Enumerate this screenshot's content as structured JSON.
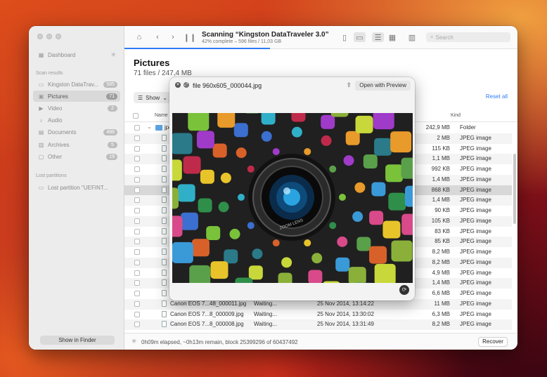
{
  "sidebar": {
    "items": [
      {
        "label": "Dashboard",
        "icon": "grid-icon"
      },
      {
        "label": "Kingston DataTrav...",
        "count": "585",
        "icon": "drive-icon"
      },
      {
        "label": "Pictures",
        "count": "71",
        "icon": "picture-icon"
      },
      {
        "label": "Video",
        "count": "2",
        "icon": "video-icon"
      },
      {
        "label": "Audio",
        "icon": "music-icon"
      },
      {
        "label": "Documents",
        "count": "488",
        "icon": "document-icon"
      },
      {
        "label": "Archives",
        "count": "5",
        "icon": "archive-icon"
      },
      {
        "label": "Other",
        "count": "19",
        "icon": "other-icon"
      },
      {
        "label": "Lost partition \"UEFINT...",
        "icon": "drive-icon"
      }
    ],
    "scan_results_label": "Scan results",
    "lost_partitions_label": "Lost partitions",
    "show_in_finder": "Show in Finder"
  },
  "toolbar": {
    "title": "Scanning “Kingston DataTraveler 3.0”",
    "subtitle": "42% complete – 596 files / 11,03 GB",
    "progress": 0.42,
    "search_placeholder": "Search"
  },
  "main": {
    "title": "Pictures",
    "subtitle": "71 files / 247,4 MB",
    "show_label": "Show",
    "reset_label": "Reset all",
    "columns": {
      "name": "Name",
      "kind": "Kind"
    }
  },
  "rows": [
    {
      "name": "jpg",
      "status": "",
      "date": "",
      "size": "242,9 MB",
      "kind": "Folder"
    },
    {
      "name": "",
      "status": "",
      "date": "",
      "size": "2 MB",
      "kind": "JPEG image"
    },
    {
      "name": "",
      "status": "",
      "date": "",
      "size": "115 KB",
      "kind": "JPEG image"
    },
    {
      "name": "",
      "status": "",
      "date": "",
      "size": "1,1 MB",
      "kind": "JPEG image"
    },
    {
      "name": "",
      "status": "",
      "date": "",
      "size": "992 KB",
      "kind": "JPEG image"
    },
    {
      "name": "",
      "status": "",
      "date": "",
      "size": "1,4 MB",
      "kind": "JPEG image"
    },
    {
      "name": "",
      "status": "",
      "date": "",
      "size": "868 KB",
      "kind": "JPEG image"
    },
    {
      "name": "",
      "status": "",
      "date": "",
      "size": "1,4 MB",
      "kind": "JPEG image"
    },
    {
      "name": "",
      "status": "",
      "date": "",
      "size": "90 KB",
      "kind": "JPEG image"
    },
    {
      "name": "",
      "status": "",
      "date": "",
      "size": "105 KB",
      "kind": "JPEG image"
    },
    {
      "name": "",
      "status": "",
      "date": "",
      "size": "83 KB",
      "kind": "JPEG image"
    },
    {
      "name": "",
      "status": "",
      "date": "",
      "size": "85 KB",
      "kind": "JPEG image"
    },
    {
      "name": "",
      "status": "",
      "date": "",
      "size": "8,2 MB",
      "kind": "JPEG image"
    },
    {
      "name": "",
      "status": "",
      "date": "",
      "size": "8,2 MB",
      "kind": "JPEG image"
    },
    {
      "name": "",
      "status": "",
      "date": "",
      "size": "4,9 MB",
      "kind": "JPEG image"
    },
    {
      "name": "",
      "status": "",
      "date": "",
      "size": "1,4 MB",
      "kind": "JPEG image"
    },
    {
      "name": "",
      "status": "",
      "date": "",
      "size": "6,6 MB",
      "kind": "JPEG image"
    },
    {
      "name": "Canon EOS 7...48_000011.jpg",
      "status": "Waiting...",
      "date": "25 Nov 2014, 13:14:22",
      "size": "11 MB",
      "kind": "JPEG image"
    },
    {
      "name": "Canon EOS 7...8_000009.jpg",
      "status": "Waiting...",
      "date": "25 Nov 2014, 13:30:02",
      "size": "6,3 MB",
      "kind": "JPEG image"
    },
    {
      "name": "Canon EOS 7...8_000008.jpg",
      "status": "Waiting...",
      "date": "25 Nov 2014, 13:31:49",
      "size": "8,2 MB",
      "kind": "JPEG image"
    }
  ],
  "status": {
    "text": "0h09m elapsed, ~0h13m remain, block 25399296 of 60437492",
    "recover_label": "Recover"
  },
  "preview": {
    "title": "file 960x605_000044.jpg",
    "open_label": "Open with Preview",
    "lens_text": "ZOOM LENS"
  }
}
